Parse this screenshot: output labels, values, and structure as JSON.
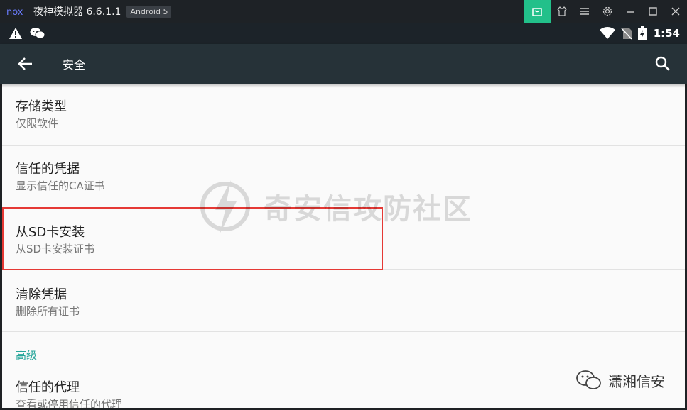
{
  "emulator": {
    "title": "夜神模拟器 6.6.1.1",
    "android_badge": "Android 5",
    "controls": [
      "shop-icon",
      "shirt-icon",
      "menu-icon",
      "gear-icon",
      "minimize-icon",
      "maximize-icon",
      "close-icon"
    ],
    "accent": "#22c08a"
  },
  "status_bar": {
    "left_icons": [
      "warning-icon",
      "wechat-icon"
    ],
    "right_icons": [
      "wifi-icon",
      "no-sim-icon",
      "battery-charging-icon"
    ],
    "time": "1:54"
  },
  "toolbar": {
    "title": "安全",
    "background": "#263238"
  },
  "preferences": [
    {
      "title": "存储类型",
      "summary": "仅限软件"
    },
    {
      "title": "信任的凭据",
      "summary": "显示信任的CA证书"
    },
    {
      "title": "从SD卡安装",
      "summary": "从SD卡安装证书",
      "highlighted": true
    },
    {
      "title": "清除凭据",
      "summary": "删除所有证书"
    }
  ],
  "category": {
    "label": "高级",
    "color": "#26a69a"
  },
  "advanced_items": [
    {
      "title": "信任的代理",
      "summary": "查看或停用信任的代理"
    }
  ],
  "watermark": {
    "text": "奇安信攻防社区"
  },
  "corner_mark": {
    "text": "潇湘信安"
  }
}
